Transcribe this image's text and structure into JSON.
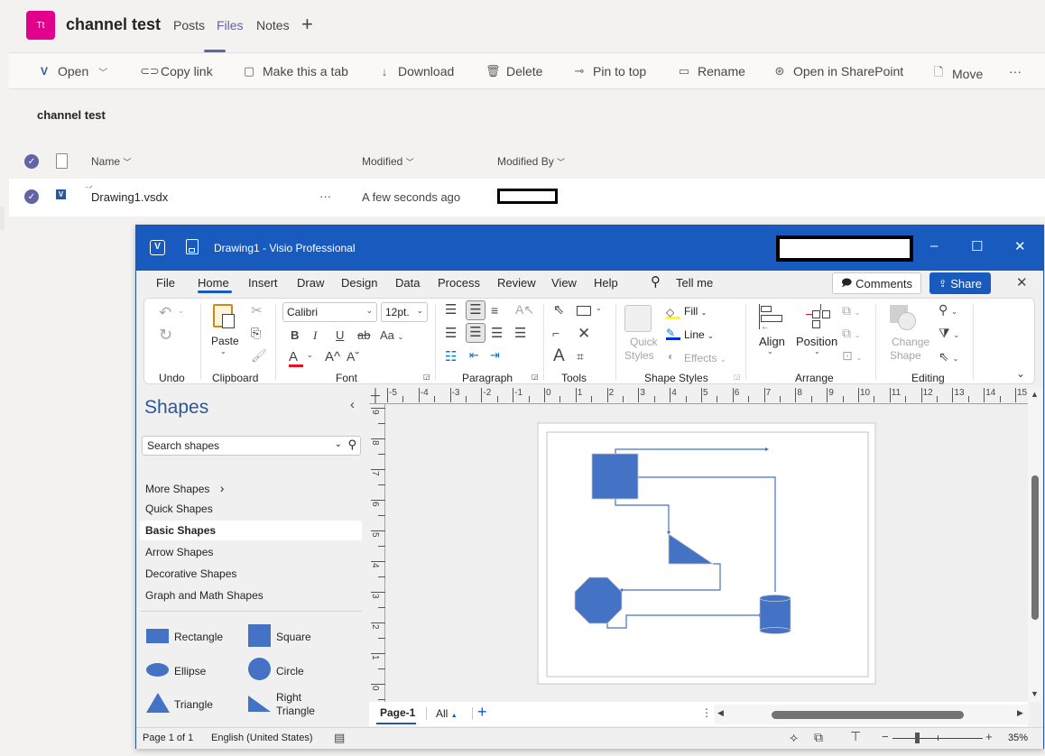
{
  "teams": {
    "avatar_initials": "Tt",
    "channel_name": "channel test",
    "tabs": [
      {
        "label": "Posts",
        "active": false
      },
      {
        "label": "Files",
        "active": true
      },
      {
        "label": "Notes",
        "active": false
      }
    ],
    "add_tab_icon": "+",
    "accent_color": "#6264a7",
    "avatar_color": "#e3008c"
  },
  "commands": [
    {
      "label": "Open",
      "icon": "visio-icon",
      "dropdown": true
    },
    {
      "label": "Copy link",
      "icon": "link-icon"
    },
    {
      "label": "Make this a tab",
      "icon": "tab-icon"
    },
    {
      "label": "Download",
      "icon": "download-icon"
    },
    {
      "label": "Delete",
      "icon": "trash-icon"
    },
    {
      "label": "Pin to top",
      "icon": "pin-icon"
    },
    {
      "label": "Rename",
      "icon": "rename-icon"
    },
    {
      "label": "Open in SharePoint",
      "icon": "sharepoint-icon"
    },
    {
      "label": "Move",
      "icon": "move-icon"
    },
    {
      "label": "···",
      "icon": "more-icon"
    }
  ],
  "files": {
    "folder_title": "channel test",
    "columns": [
      "Name",
      "Modified",
      "Modified By"
    ],
    "rows": [
      {
        "name": "Drawing1.vsdx",
        "more": "···",
        "modified": "A few seconds ago",
        "modified_by": "[redacted]"
      }
    ]
  },
  "visio": {
    "title": "Drawing1  -  Visio Professional",
    "title_bar_color": "#185abd",
    "window_controls": {
      "minimize": "–",
      "maximize": "☐",
      "close": "✕"
    },
    "menu": [
      "File",
      "Home",
      "Insert",
      "Draw",
      "Design",
      "Data",
      "Process",
      "Review",
      "View",
      "Help"
    ],
    "active_menu": "Home",
    "tell_me": "Tell me",
    "comments_label": "Comments",
    "share_label": "Share",
    "ribbon": {
      "groups": {
        "undo": "Undo",
        "clipboard": "Clipboard",
        "font": "Font",
        "paragraph": "Paragraph",
        "tools": "Tools",
        "shape_styles": "Shape Styles",
        "arrange": "Arrange",
        "editing": "Editing"
      },
      "paste_label": "Paste",
      "font_name": "Calibri",
      "font_size": "12pt.",
      "bold": "B",
      "italic": "I",
      "underline": "U",
      "strikethrough": "ab",
      "change_case": "Aa",
      "font_color": "A",
      "grow_font": "A^",
      "shrink_font": "Aˇ",
      "quick_styles": [
        "Quick",
        "Styles"
      ],
      "fill": "Fill",
      "line": "Line",
      "effects": "Effects",
      "align": "Align",
      "position": "Position",
      "change_shape": [
        "Change",
        "Shape"
      ],
      "tool_text": "A",
      "fill_color": "#ffff00",
      "line_color": "#0033cc",
      "font_color_value": "#e81123"
    },
    "shapes_pane": {
      "title": "Shapes",
      "search_placeholder": "Search shapes",
      "more_shapes": "More Shapes",
      "stencils": [
        "Quick Shapes",
        "Basic Shapes",
        "Arrow Shapes",
        "Decorative Shapes",
        "Graph and Math Shapes"
      ],
      "selected_stencil": "Basic Shapes",
      "masters": [
        {
          "label": "Rectangle",
          "shape": "rectangle"
        },
        {
          "label": "Square",
          "shape": "square"
        },
        {
          "label": "Ellipse",
          "shape": "ellipse"
        },
        {
          "label": "Circle",
          "shape": "circle"
        },
        {
          "label": "Triangle",
          "shape": "triangle"
        },
        {
          "label": "Right Triangle",
          "label_line1": "Right",
          "label_line2": "Triangle",
          "shape": "right-triangle"
        }
      ],
      "shape_color": "#4472c4"
    },
    "ruler_h": [
      "-5",
      "-4",
      "-3",
      "-2",
      "-1",
      "0",
      "1",
      "2",
      "3",
      "4",
      "5",
      "6",
      "7",
      "8",
      "9",
      "10",
      "11",
      "12",
      "13",
      "14",
      "15"
    ],
    "ruler_v": [
      "9",
      "8",
      "7",
      "6",
      "5",
      "4",
      "3",
      "2",
      "1",
      "0"
    ],
    "diagram": {
      "shapes": [
        "square",
        "right-triangle",
        "octagon",
        "cylinder"
      ],
      "connector_color": "#4472c4"
    },
    "page_tabs": {
      "current": "Page-1",
      "all": "All",
      "add": "+"
    },
    "status": {
      "page": "Page 1 of 1",
      "language": "English (United States)",
      "zoom": "35%",
      "zoom_fraction": 0.35
    }
  }
}
